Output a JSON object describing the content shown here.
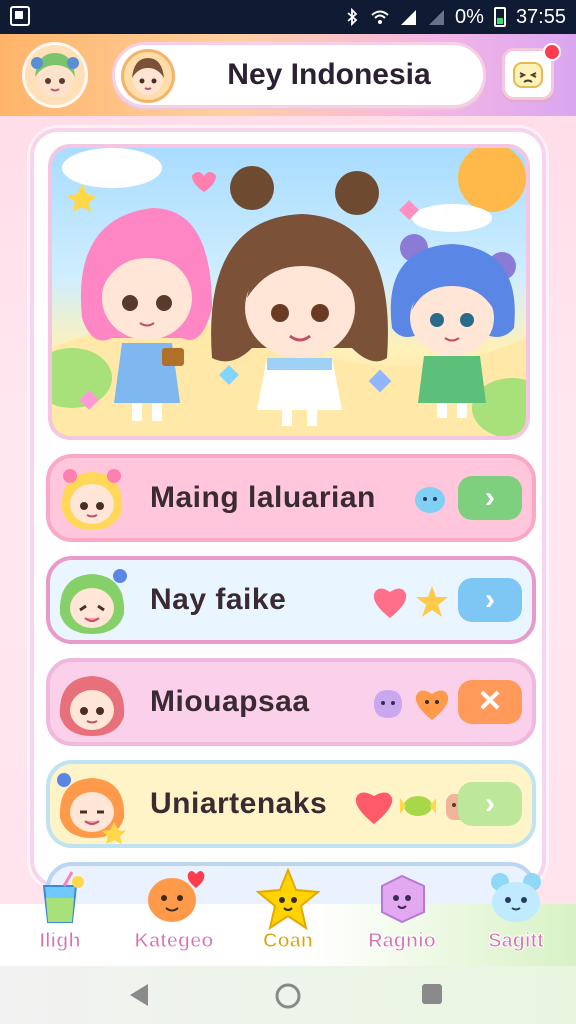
{
  "status_bar": {
    "battery_text": "0%",
    "time": "37:55",
    "icons": [
      "screenshot-icon",
      "bluetooth-icon",
      "wifi-icon",
      "signal-icon",
      "signal-empty-icon",
      "battery-icon"
    ]
  },
  "header": {
    "title": "Ney Indonesia",
    "left_avatar": "green-hair-avatar",
    "title_avatar": "brown-hair-avatar",
    "right_button_icon": "cute-face-icon",
    "notification": true
  },
  "hero": {
    "characters": [
      "pink-hair-girl",
      "brown-hair-girl",
      "blue-hair-girl"
    ]
  },
  "list": [
    {
      "label": "Maing laluarian",
      "button_icon": "chevron-right-icon",
      "button_symbol": "›",
      "button_color": "#7fd07e",
      "stickers": [
        "blue-blob-sticker"
      ]
    },
    {
      "label": "Nay faike",
      "button_icon": "chevron-right-icon",
      "button_symbol": "›",
      "button_color": "#7ec7f4",
      "stickers": [
        "red-heart-sticker",
        "yellow-star-sticker"
      ]
    },
    {
      "label": "Miouapsaa",
      "button_icon": "close-icon",
      "button_symbol": "✕",
      "button_color": "#ff9a5a",
      "stickers": [
        "purple-blob-sticker",
        "orange-heart-sticker"
      ]
    },
    {
      "label": "Uniartenaks",
      "button_icon": "chevron-right-icon",
      "button_symbol": "›",
      "button_color": "#bde79a",
      "stickers": [
        "red-heart-sticker",
        "candy-sticker",
        "cookie-sticker"
      ]
    },
    {
      "label": "",
      "button_icon": "",
      "button_symbol": "",
      "button_color": "",
      "stickers": []
    }
  ],
  "bottom_nav": [
    {
      "label": "Iligh",
      "icon": "drink-icon",
      "active": false
    },
    {
      "label": "Kategeo",
      "icon": "orange-heart-icon",
      "active": false
    },
    {
      "label": "Coan",
      "icon": "yellow-star-icon",
      "active": true
    },
    {
      "label": "Ragnio",
      "icon": "purple-cube-icon",
      "active": false
    },
    {
      "label": "Sagitt",
      "icon": "blue-bear-icon",
      "active": false
    }
  ],
  "system_nav": [
    "back-icon",
    "home-icon",
    "recents-icon"
  ],
  "colors": {
    "header_gradient_start": "#ffb46a",
    "header_gradient_end": "#d9a6f0",
    "page_background": "#ffd9e6",
    "nav_label": "#d86fb3",
    "nav_active_label": "#d9a400"
  }
}
